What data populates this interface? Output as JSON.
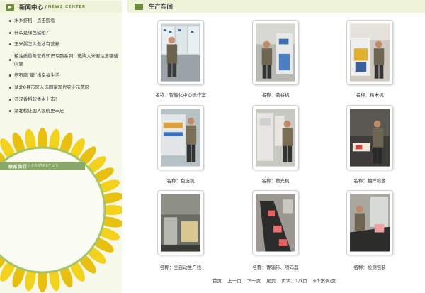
{
  "news_section": {
    "title": "新闻中心",
    "separator": "/",
    "subtitle": "NEWS CENTER",
    "items": [
      "水乡虾稻　点击观看",
      "什么是绿色储粮？",
      "王米粥怎么煮才有营养",
      "粮油质量与营养知识专题系列：选购大米要注意哪些问题",
      "老石磨“磨”出幸福生活",
      "湖北8县市区入选国家现代农业示范区",
      "江汉香稻软香米上市！",
      "湖北粮让国人饭碗更丰足"
    ]
  },
  "contact_section": {
    "title": "联系我们",
    "separator": "/",
    "subtitle": "CONTACT US"
  },
  "workshop": {
    "title": "生产车间",
    "items": [
      {
        "caption": "名称：智能化中心操作室"
      },
      {
        "caption": "名称：砻谷机"
      },
      {
        "caption": "名称：精米机"
      },
      {
        "caption": "名称：色选机"
      },
      {
        "caption": "名称：抛光机"
      },
      {
        "caption": "名称：抽样检查"
      },
      {
        "caption": "名称：全自动生产线"
      },
      {
        "caption": "名称：传输带、喷码器"
      },
      {
        "caption": "名称：检测包装"
      }
    ]
  },
  "pager": {
    "first": "首页",
    "prev": "上一页",
    "next": "下一页",
    "last": "尾页",
    "page_info": "页次：1/1页",
    "count": "9个案例/页"
  },
  "colors": {
    "accent_green": "#6a8c3c",
    "header_bg": "#eef3da",
    "sidebar_bg": "#f6f8ea",
    "sun_yellow": "#f2d21a"
  }
}
